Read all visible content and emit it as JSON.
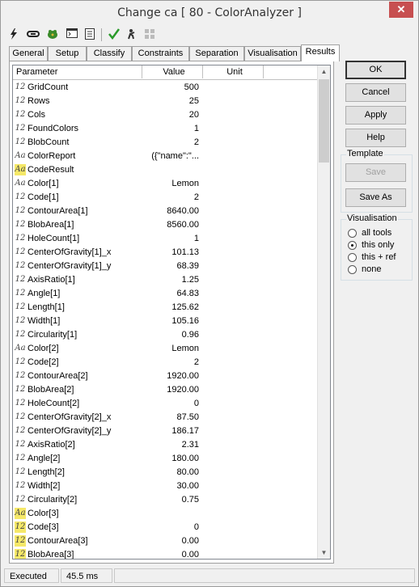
{
  "window": {
    "title": "Change ca [ 80 - ColorAnalyzer ]",
    "close_label": "✕"
  },
  "toolbar": {
    "icons": [
      "lightning-icon",
      "link-icon",
      "frog-icon",
      "console-icon",
      "list-icon",
      "checkmark-icon",
      "run-icon",
      "grid-icon"
    ]
  },
  "tabs": [
    "General",
    "Setup",
    "Classify",
    "Constraints",
    "Separation",
    "Visualisation",
    "Results"
  ],
  "active_tab": "Results",
  "table": {
    "columns": [
      "Parameter",
      "Value",
      "Unit"
    ],
    "rows": [
      {
        "icon": "12",
        "hl": false,
        "name": "GridCount",
        "value": "500"
      },
      {
        "icon": "12",
        "hl": false,
        "name": "Rows",
        "value": "25"
      },
      {
        "icon": "12",
        "hl": false,
        "name": "Cols",
        "value": "20"
      },
      {
        "icon": "12",
        "hl": false,
        "name": "FoundColors",
        "value": "1"
      },
      {
        "icon": "12",
        "hl": false,
        "name": "BlobCount",
        "value": "2"
      },
      {
        "icon": "Aa",
        "hl": false,
        "name": "ColorReport",
        "value": "({\"name\":\"..."
      },
      {
        "icon": "Aa",
        "hl": true,
        "name": "CodeResult",
        "value": ""
      },
      {
        "icon": "Aa",
        "hl": false,
        "name": "Color[1]",
        "value": "Lemon"
      },
      {
        "icon": "12",
        "hl": false,
        "name": "Code[1]",
        "value": "2"
      },
      {
        "icon": "12",
        "hl": false,
        "name": "ContourArea[1]",
        "value": "8640.00"
      },
      {
        "icon": "12",
        "hl": false,
        "name": "BlobArea[1]",
        "value": "8560.00"
      },
      {
        "icon": "12",
        "hl": false,
        "name": "HoleCount[1]",
        "value": "1"
      },
      {
        "icon": "12",
        "hl": false,
        "name": "CenterOfGravity[1]_x",
        "value": "101.13"
      },
      {
        "icon": "12",
        "hl": false,
        "name": "CenterOfGravity[1]_y",
        "value": "68.39"
      },
      {
        "icon": "12",
        "hl": false,
        "name": "AxisRatio[1]",
        "value": "1.25"
      },
      {
        "icon": "12",
        "hl": false,
        "name": "Angle[1]",
        "value": "64.83"
      },
      {
        "icon": "12",
        "hl": false,
        "name": "Length[1]",
        "value": "125.62"
      },
      {
        "icon": "12",
        "hl": false,
        "name": "Width[1]",
        "value": "105.16"
      },
      {
        "icon": "12",
        "hl": false,
        "name": "Circularity[1]",
        "value": "0.96"
      },
      {
        "icon": "Aa",
        "hl": false,
        "name": "Color[2]",
        "value": "Lemon"
      },
      {
        "icon": "12",
        "hl": false,
        "name": "Code[2]",
        "value": "2"
      },
      {
        "icon": "12",
        "hl": false,
        "name": "ContourArea[2]",
        "value": "1920.00"
      },
      {
        "icon": "12",
        "hl": false,
        "name": "BlobArea[2]",
        "value": "1920.00"
      },
      {
        "icon": "12",
        "hl": false,
        "name": "HoleCount[2]",
        "value": "0"
      },
      {
        "icon": "12",
        "hl": false,
        "name": "CenterOfGravity[2]_x",
        "value": "87.50"
      },
      {
        "icon": "12",
        "hl": false,
        "name": "CenterOfGravity[2]_y",
        "value": "186.17"
      },
      {
        "icon": "12",
        "hl": false,
        "name": "AxisRatio[2]",
        "value": "2.31"
      },
      {
        "icon": "12",
        "hl": false,
        "name": "Angle[2]",
        "value": "180.00"
      },
      {
        "icon": "12",
        "hl": false,
        "name": "Length[2]",
        "value": "80.00"
      },
      {
        "icon": "12",
        "hl": false,
        "name": "Width[2]",
        "value": "30.00"
      },
      {
        "icon": "12",
        "hl": false,
        "name": "Circularity[2]",
        "value": "0.75"
      },
      {
        "icon": "Aa",
        "hl": true,
        "name": "Color[3]",
        "value": ""
      },
      {
        "icon": "12",
        "hl": true,
        "name": "Code[3]",
        "value": "0"
      },
      {
        "icon": "12",
        "hl": true,
        "name": "ContourArea[3]",
        "value": "0.00"
      },
      {
        "icon": "12",
        "hl": true,
        "name": "BlobArea[3]",
        "value": "0.00"
      }
    ]
  },
  "buttons": {
    "ok": "OK",
    "cancel": "Cancel",
    "apply": "Apply",
    "help": "Help"
  },
  "template": {
    "legend": "Template",
    "save": "Save",
    "save_as": "Save As"
  },
  "visualisation": {
    "legend": "Visualisation",
    "options": [
      "all tools",
      "this only",
      "this + ref",
      "none"
    ],
    "selected": "this only"
  },
  "status": {
    "state": "Executed",
    "time": "45.5 ms"
  }
}
